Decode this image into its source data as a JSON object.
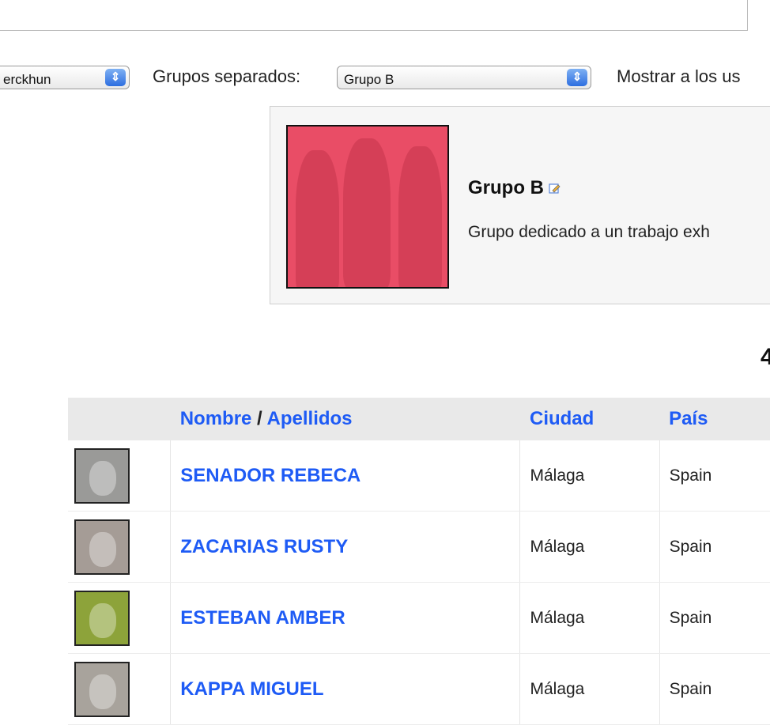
{
  "toolbar": {
    "user_select_value": "erckhun",
    "groups_label": "Grupos separados:",
    "group_select_value": "Grupo B",
    "show_label": "Mostrar a los us"
  },
  "group": {
    "name": "Grupo B",
    "description": "Grupo dedicado a un trabajo exh"
  },
  "member_count": "4",
  "table": {
    "headers": {
      "name_first": "Nombre",
      "sep": " / ",
      "name_last": "Apellidos",
      "city": "Ciudad",
      "country": "País"
    },
    "rows": [
      {
        "name": "SENADOR REBECA",
        "city": "Málaga",
        "country": "Spain",
        "avatar_color": "#9a9a98"
      },
      {
        "name": "ZACARIAS RUSTY",
        "city": "Málaga",
        "country": "Spain",
        "avatar_color": "#a59c96"
      },
      {
        "name": "ESTEBAN AMBER",
        "city": "Málaga",
        "country": "Spain",
        "avatar_color": "#8da33a"
      },
      {
        "name": "KAPPA MIGUEL",
        "city": "Málaga",
        "country": "Spain",
        "avatar_color": "#a8a39c"
      }
    ]
  },
  "colors": {
    "link": "#1e5bf5",
    "group_photo_tint": "#e94d66",
    "header_bg": "#e9e9e9"
  },
  "icons": {
    "select_arrows": "up-down-arrows-icon",
    "edit": "edit-pencil-icon"
  }
}
